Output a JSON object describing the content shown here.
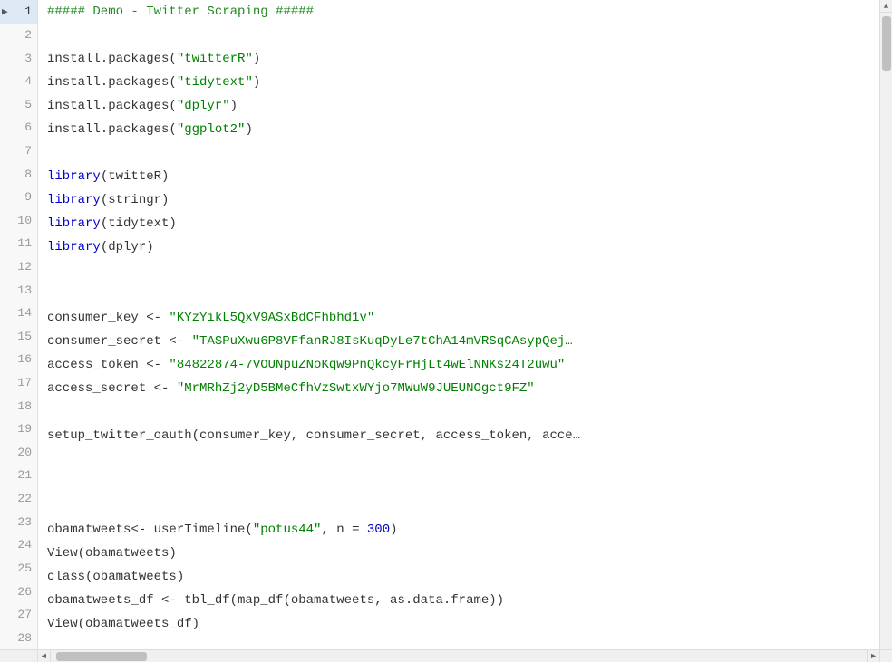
{
  "editor": {
    "title": "Twitter Scraping Demo",
    "lines": [
      {
        "num": 1,
        "active": true,
        "arrow": true,
        "tokens": [
          {
            "type": "comment",
            "text": "##### Demo - Twitter Scraping #####"
          }
        ]
      },
      {
        "num": 2,
        "active": false,
        "arrow": false,
        "tokens": []
      },
      {
        "num": 3,
        "active": false,
        "arrow": false,
        "tokens": [
          {
            "type": "plain",
            "text": "install.packages("
          },
          {
            "type": "string",
            "text": "\"twitterR\""
          },
          {
            "type": "plain",
            "text": ")"
          }
        ]
      },
      {
        "num": 4,
        "active": false,
        "arrow": false,
        "tokens": [
          {
            "type": "plain",
            "text": "install.packages("
          },
          {
            "type": "string",
            "text": "\"tidytext\""
          },
          {
            "type": "plain",
            "text": ")"
          }
        ]
      },
      {
        "num": 5,
        "active": false,
        "arrow": false,
        "tokens": [
          {
            "type": "plain",
            "text": "install.packages("
          },
          {
            "type": "string",
            "text": "\"dplyr\""
          },
          {
            "type": "plain",
            "text": ")"
          }
        ]
      },
      {
        "num": 6,
        "active": false,
        "arrow": false,
        "tokens": [
          {
            "type": "plain",
            "text": "install.packages("
          },
          {
            "type": "string",
            "text": "\"ggplot2\""
          },
          {
            "type": "plain",
            "text": ")"
          }
        ]
      },
      {
        "num": 7,
        "active": false,
        "arrow": false,
        "tokens": []
      },
      {
        "num": 8,
        "active": false,
        "arrow": false,
        "tokens": [
          {
            "type": "keyword",
            "text": "library"
          },
          {
            "type": "plain",
            "text": "(twitteR)"
          }
        ]
      },
      {
        "num": 9,
        "active": false,
        "arrow": false,
        "tokens": [
          {
            "type": "keyword",
            "text": "library"
          },
          {
            "type": "plain",
            "text": "(stringr)"
          }
        ]
      },
      {
        "num": 10,
        "active": false,
        "arrow": false,
        "tokens": [
          {
            "type": "keyword",
            "text": "library"
          },
          {
            "type": "plain",
            "text": "(tidytext)"
          }
        ]
      },
      {
        "num": 11,
        "active": false,
        "arrow": false,
        "tokens": [
          {
            "type": "keyword",
            "text": "library"
          },
          {
            "type": "plain",
            "text": "(dplyr)"
          }
        ]
      },
      {
        "num": 12,
        "active": false,
        "arrow": false,
        "tokens": []
      },
      {
        "num": 13,
        "active": false,
        "arrow": false,
        "tokens": []
      },
      {
        "num": 14,
        "active": false,
        "arrow": false,
        "tokens": [
          {
            "type": "plain",
            "text": "consumer_key <- "
          },
          {
            "type": "string",
            "text": "\"KYzYikL5QxV9ASxBdCFhbhd1v\""
          }
        ]
      },
      {
        "num": 15,
        "active": false,
        "arrow": false,
        "tokens": [
          {
            "type": "plain",
            "text": "consumer_secret <- "
          },
          {
            "type": "string",
            "text": "\"TASPuXwu6P8VFfanRJ8IsKuqDyLe7tChA14mVRSqCAsypQej…"
          }
        ]
      },
      {
        "num": 16,
        "active": false,
        "arrow": false,
        "tokens": [
          {
            "type": "plain",
            "text": "access_token <- "
          },
          {
            "type": "string",
            "text": "\"84822874-7VOUNpuZNoKqw9PnQkcyFrHjLt4wElNNKs24T2uwu\""
          }
        ]
      },
      {
        "num": 17,
        "active": false,
        "arrow": false,
        "tokens": [
          {
            "type": "plain",
            "text": "access_secret <- "
          },
          {
            "type": "string",
            "text": "\"MrMRhZj2yD5BMeCfhVzSwtxWYjo7MWuW9JUEUNOgct9FZ\""
          }
        ]
      },
      {
        "num": 18,
        "active": false,
        "arrow": false,
        "tokens": []
      },
      {
        "num": 19,
        "active": false,
        "arrow": false,
        "tokens": [
          {
            "type": "plain",
            "text": "setup_twitter_oauth(consumer_key, consumer_secret, access_token, acce…"
          }
        ]
      },
      {
        "num": 20,
        "active": false,
        "arrow": false,
        "tokens": []
      },
      {
        "num": 21,
        "active": false,
        "arrow": false,
        "tokens": []
      },
      {
        "num": 22,
        "active": false,
        "arrow": false,
        "tokens": []
      },
      {
        "num": 23,
        "active": false,
        "arrow": false,
        "tokens": [
          {
            "type": "plain",
            "text": "obamatweets<- userTimeline("
          },
          {
            "type": "string",
            "text": "\"potus44\""
          },
          {
            "type": "plain",
            "text": ", n = "
          },
          {
            "type": "number-val",
            "text": "300"
          },
          {
            "type": "plain",
            "text": ")"
          }
        ]
      },
      {
        "num": 24,
        "active": false,
        "arrow": false,
        "tokens": [
          {
            "type": "plain",
            "text": "View(obamatweets)"
          }
        ]
      },
      {
        "num": 25,
        "active": false,
        "arrow": false,
        "tokens": [
          {
            "type": "plain",
            "text": "class(obamatweets)"
          }
        ]
      },
      {
        "num": 26,
        "active": false,
        "arrow": false,
        "tokens": [
          {
            "type": "plain",
            "text": "obamatweets_df <- tbl_df(map_df(obamatweets, as.data.frame))"
          }
        ]
      },
      {
        "num": 27,
        "active": false,
        "arrow": false,
        "tokens": [
          {
            "type": "plain",
            "text": "View(obamatweets_df)"
          }
        ]
      },
      {
        "num": 28,
        "active": false,
        "arrow": false,
        "tokens": []
      }
    ]
  },
  "scrollbar": {
    "v_arrow_up": "▲",
    "v_arrow_down": "▼",
    "h_arrow_left": "◄",
    "h_arrow_right": "►"
  }
}
